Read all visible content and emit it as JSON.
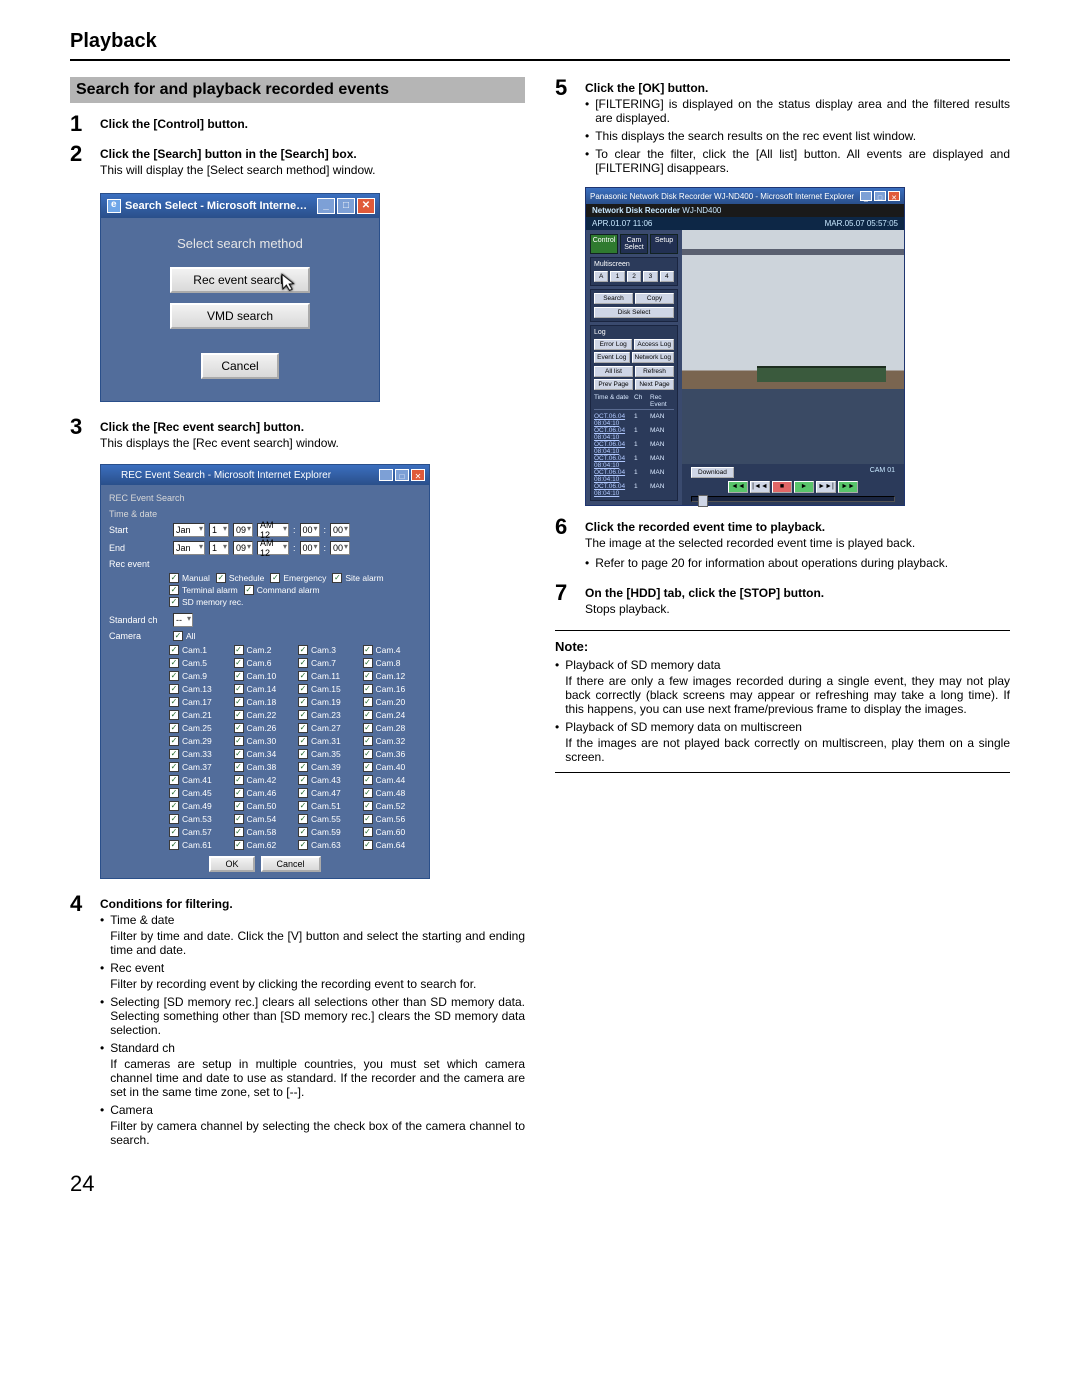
{
  "page": {
    "header": "Playback",
    "number": "24",
    "section_title": "Search for and playback recorded events"
  },
  "steps": {
    "s1": {
      "title": "Click the [Control] button."
    },
    "s2": {
      "title": "Click the [Search] button in the [Search] box.",
      "text": "This will display the [Select search method] window."
    },
    "s3": {
      "title": "Click the [Rec event search] button.",
      "text": "This displays the [Rec event search] window."
    },
    "s4": {
      "title": "Conditions for filtering.",
      "items": [
        {
          "label": "Time & date",
          "text": "Filter by time and date. Click the [V] button and select the starting and ending time and date."
        },
        {
          "label": "Rec event",
          "text": "Filter by recording event by clicking the recording event to search for."
        },
        {
          "label": "",
          "text": "Selecting [SD memory rec.] clears all selections other than SD memory data. Selecting something other than [SD memory rec.] clears the SD memory data selection."
        },
        {
          "label": "Standard ch",
          "text": "If cameras are setup in multiple countries, you must set which camera channel time and date to use as standard. If the recorder and the camera are set in the same time zone, set to [--]."
        },
        {
          "label": "Camera",
          "text": "Filter by camera channel by selecting the check box of the camera channel to search."
        }
      ]
    },
    "s5": {
      "title": "Click the [OK] button.",
      "bullets": [
        "[FILTERING] is displayed on the status display area and the filtered results are displayed.",
        "This displays the search results on the rec event list window.",
        "To clear the filter, click the [All list] button. All events are displayed and [FILTERING] disappears."
      ]
    },
    "s6": {
      "title": "Click the recorded event time to playback.",
      "text": "The image at the selected recorded event time is played back.",
      "bullets": [
        "Refer to page 20 for information about operations during playback."
      ]
    },
    "s7": {
      "title": "On the [HDD] tab, click the [STOP] button.",
      "text": "Stops playback."
    }
  },
  "note": {
    "heading": "Note:",
    "items": [
      {
        "label": "Playback of SD memory data",
        "text": "If there are only a few images recorded during a single event, they may not play back correctly (black screens may appear or refreshing may take a long time). If this happens, you can use next frame/previous frame to display the images."
      },
      {
        "label": "Playback of SD memory data on multiscreen",
        "text": "If the images are not played back correctly on multiscreen, play them on a single screen."
      }
    ]
  },
  "dialog1": {
    "title": "Search Select - Microsoft Interne…",
    "heading": "Select search method",
    "btn_rec": "Rec event search",
    "btn_vmd": "VMD search",
    "btn_cancel": "Cancel"
  },
  "dialog2": {
    "title": "REC Event Search - Microsoft Internet Explorer",
    "h": "REC Event Search",
    "section1": "Time & date",
    "row_start": "Start",
    "row_end": "End",
    "month": "Jan",
    "day": "1",
    "year": "09",
    "ampm": "AM 12",
    "min": "00",
    "sec": "00",
    "section2": "Rec event",
    "rec_opts": [
      "Manual",
      "Schedule",
      "Emergency",
      "Site alarm",
      "Terminal alarm",
      "Command alarm",
      "SD memory rec."
    ],
    "section3": "Standard ch",
    "std_val": "--",
    "cam_all": "All",
    "cams": [
      "Cam.1",
      "Cam.2",
      "Cam.3",
      "Cam.4",
      "Cam.5",
      "Cam.6",
      "Cam.7",
      "Cam.8",
      "Cam.9",
      "Cam.10",
      "Cam.11",
      "Cam.12",
      "Cam.13",
      "Cam.14",
      "Cam.15",
      "Cam.16",
      "Cam.17",
      "Cam.18",
      "Cam.19",
      "Cam.20",
      "Cam.21",
      "Cam.22",
      "Cam.23",
      "Cam.24",
      "Cam.25",
      "Cam.26",
      "Cam.27",
      "Cam.28",
      "Cam.29",
      "Cam.30",
      "Cam.31",
      "Cam.32",
      "Cam.33",
      "Cam.34",
      "Cam.35",
      "Cam.36",
      "Cam.37",
      "Cam.38",
      "Cam.39",
      "Cam.40",
      "Cam.41",
      "Cam.42",
      "Cam.43",
      "Cam.44",
      "Cam.45",
      "Cam.46",
      "Cam.47",
      "Cam.48",
      "Cam.49",
      "Cam.50",
      "Cam.51",
      "Cam.52",
      "Cam.53",
      "Cam.54",
      "Cam.55",
      "Cam.56",
      "Cam.57",
      "Cam.58",
      "Cam.59",
      "Cam.60",
      "Cam.61",
      "Cam.62",
      "Cam.63",
      "Cam.64"
    ],
    "camera_lbl": "Camera",
    "ok": "OK",
    "cancel": "Cancel"
  },
  "viewer": {
    "title": "Panasonic Network Disk Recorder WJ-ND400 - Microsoft Internet Explorer",
    "brand": "Network Disk Recorder",
    "model": "WJ-ND400",
    "datetime_l": "APR.01.07 11:06",
    "datetime_r": "MAR.05.07 05:57:05",
    "tabs": [
      "Control",
      "Cam Select",
      "Setup"
    ],
    "left": {
      "multiscreen": "Multiscreen",
      "search": "Search",
      "copy": "Copy",
      "disk_sel": "Disk Select",
      "log": "Log",
      "err": "Error Log",
      "acc": "Access Log",
      "evt": "Event Log",
      "net": "Network Log",
      "all": "All list",
      "ref": "Refresh",
      "prev": "Prev Page",
      "next": "Next Page",
      "evh": {
        "c1": "Time & date",
        "c2": "Ch",
        "c3": "Rec Event"
      },
      "events": [
        {
          "t": "OCT.06.04 08:04:10",
          "c": "1",
          "e": "MAN"
        },
        {
          "t": "OCT.06.04 08:04:10",
          "c": "1",
          "e": "MAN"
        },
        {
          "t": "OCT.06.04 08:04:10",
          "c": "1",
          "e": "MAN"
        },
        {
          "t": "OCT.06.04 08:04:10",
          "c": "1",
          "e": "MAN"
        },
        {
          "t": "OCT.06.04 08:04:10",
          "c": "1",
          "e": "MAN"
        },
        {
          "t": "OCT.06.04 08:04:10",
          "c": "1",
          "e": "MAN"
        }
      ]
    },
    "pb": {
      "rew": "◄◄",
      "prev": "|◄◄",
      "stop": "■",
      "play": "►",
      "next": "►►|",
      "ff": "►►"
    },
    "cam_lbl": "CAM 01",
    "download": "Download"
  }
}
